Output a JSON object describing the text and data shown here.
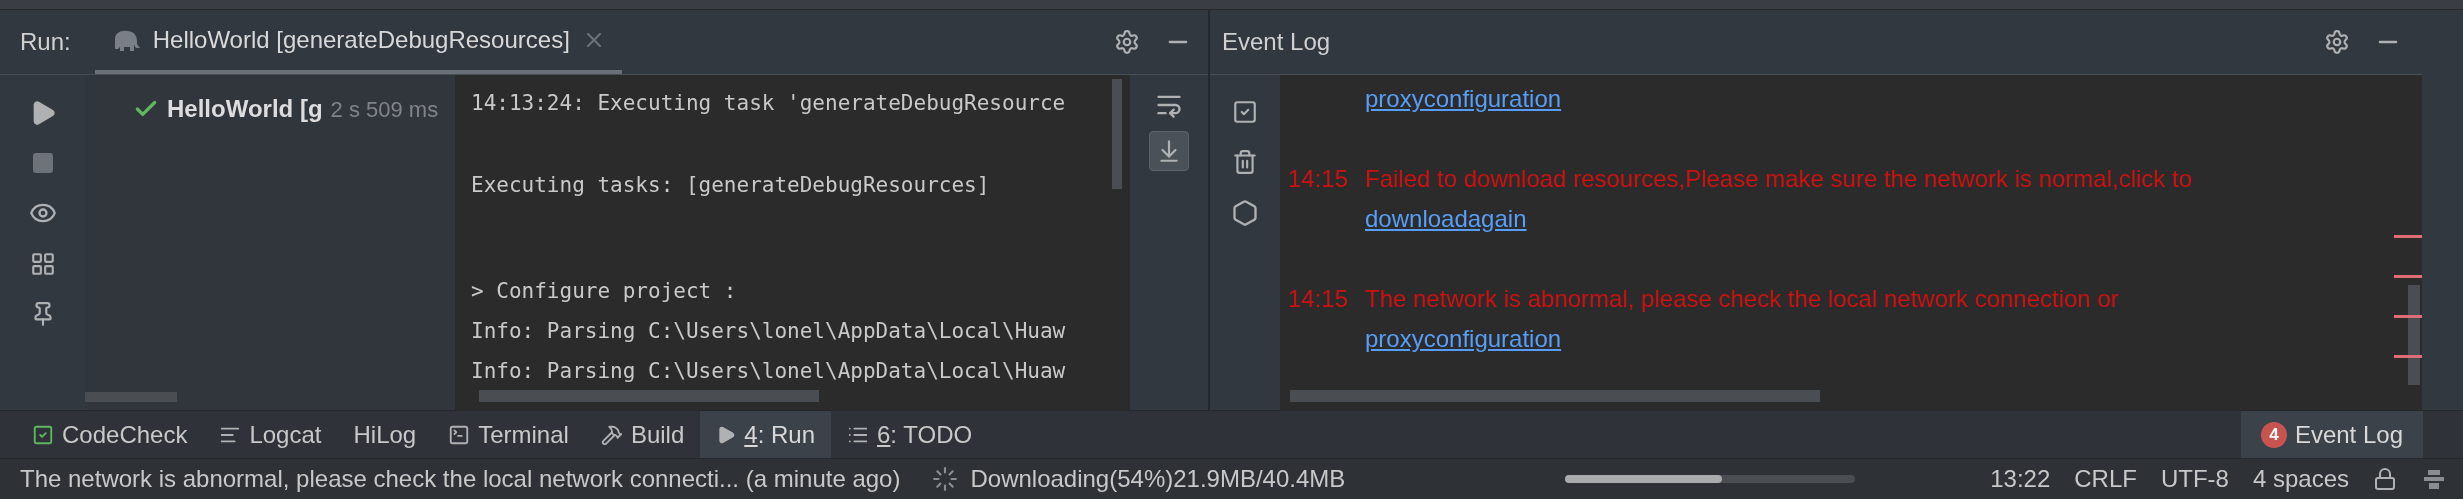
{
  "run_panel": {
    "label": "Run:",
    "tab": {
      "title": "HelloWorld [generateDebugResources]",
      "selected": true
    },
    "tree": [
      {
        "name": "HelloWorld [g",
        "time": "2 s 509 ms",
        "succeeded": true
      }
    ],
    "console_blocks": [
      [
        "14:13:24: Executing task 'generateDebugResource"
      ],
      [
        "Executing tasks: [generateDebugResources]"
      ],
      [
        "> Configure project :",
        "Info: Parsing C:\\Users\\lonel\\AppData\\Local\\Huaw",
        "Info: Parsing C:\\Users\\lonel\\AppData\\Local\\Huaw"
      ]
    ],
    "scroll_to_end": true
  },
  "event_log": {
    "title": "Event Log",
    "entries": [
      {
        "link": "proxyconfiguration"
      },
      {
        "time": "14:15",
        "text": "Failed to download resources,Please make sure the network is normal,click to",
        "link": "downloadagain"
      },
      {
        "time": "14:15",
        "text": "The network is abnormal, please check the local network connection or",
        "link": "proxyconfiguration"
      }
    ]
  },
  "tool_tabs": [
    {
      "kind": "codecheck",
      "label": "CodeCheck",
      "selected": false
    },
    {
      "kind": "logcat",
      "label": "Logcat",
      "selected": false
    },
    {
      "kind": "plain",
      "label": "HiLog",
      "selected": false
    },
    {
      "kind": "terminal",
      "label": "Terminal",
      "selected": false
    },
    {
      "kind": "build",
      "label": "Build",
      "selected": false
    },
    {
      "kind": "run",
      "mnemonic": "4",
      "label": ": Run",
      "selected": true
    },
    {
      "kind": "todo",
      "mnemonic": "6",
      "label": ": TODO",
      "selected": false
    }
  ],
  "event_log_button": {
    "badge": "4",
    "label": "Event Log"
  },
  "status_bar": {
    "message": "The network is abnormal, please check the local network connecti... (a minute ago)",
    "progress": {
      "label": "Downloading(54%)21.9MB/40.4MB",
      "level": 0.54
    },
    "items": [
      "13:22",
      "CRLF",
      "UTF-8",
      "4 spaces"
    ]
  }
}
